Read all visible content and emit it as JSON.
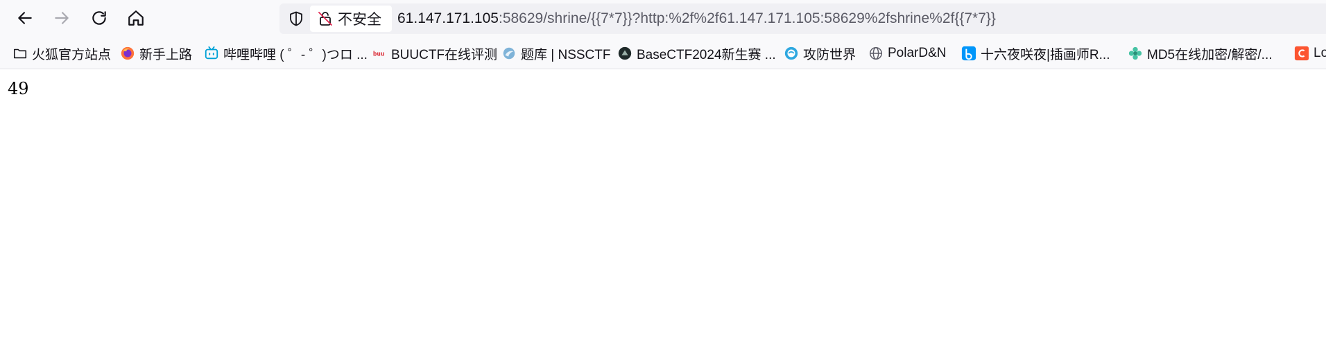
{
  "toolbar": {
    "back_icon": "arrow-left-icon",
    "forward_icon": "arrow-right-icon",
    "reload_icon": "reload-icon",
    "home_icon": "home-icon"
  },
  "urlbar": {
    "shield_icon": "shield-icon",
    "security_label": "不安全",
    "url_host": "61.147.171.105",
    "url_rest": ":58629/shrine/{{7*7}}?http:%2f%2f61.147.171.105:58629%2fshrine%2f{{7*7}}"
  },
  "bookmarks": [
    {
      "label": "火狐官方站点",
      "icon": "folder-icon"
    },
    {
      "label": "新手上路",
      "icon": "firefox-icon"
    },
    {
      "label": "哔哩哔哩 ( ゜- ゜)つロ ...",
      "icon": "bilibili-icon"
    },
    {
      "label": "BUUCTF在线评测",
      "icon": "buuctf-icon"
    },
    {
      "label": "题库 | NSSCTF",
      "icon": "nssctf-icon"
    },
    {
      "label": "BaseCTF2024新生赛 ...",
      "icon": "basectf-icon"
    },
    {
      "label": "攻防世界",
      "icon": "adworld-icon"
    },
    {
      "label": "PolarD&N",
      "icon": "globe-icon"
    },
    {
      "label": "十六夜咲夜|插画师R...",
      "icon": "b-logo-icon"
    },
    {
      "label": "MD5在线加密/解密/...",
      "icon": "flower-icon"
    },
    {
      "label": "Lo",
      "icon": "csdn-icon"
    }
  ],
  "page": {
    "result": "49"
  },
  "colors": {
    "toolbar_bg": "#f9f9fb",
    "urlbar_bg": "#f0f0f4",
    "bilibili": "#00a1d6",
    "firefox": "#ff7139",
    "csdn": "#fc5531",
    "flower": "#46c3a4"
  }
}
